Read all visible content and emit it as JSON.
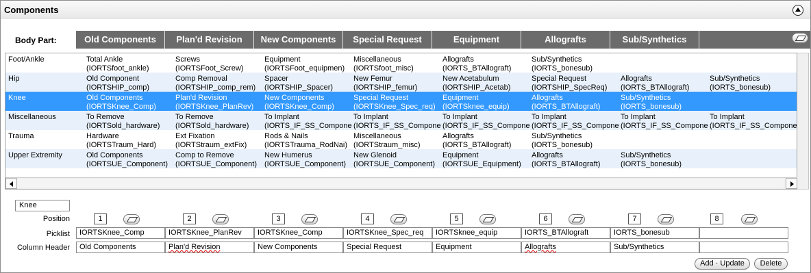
{
  "panel": {
    "title": "Components"
  },
  "body_part_label": "Body Part:",
  "tabs": [
    "Old Components",
    "Plan'd Revision",
    "New Components",
    "Special Request",
    "Equipment",
    "Allografts",
    "Sub/Synthetics"
  ],
  "grid": {
    "rows": [
      {
        "label": "Foot/Ankle",
        "cells": [
          [
            "Total Ankle",
            "(IORTSfoot_ankle)"
          ],
          [
            "Screws",
            "(IORTSFoot_Screw)"
          ],
          [
            "Equipment",
            "(IORTSFoot_equipmen)"
          ],
          [
            "Miscellaneous",
            "(IORTSfoot_misc)"
          ],
          [
            "Allografts",
            "(IORTS_BTAllograft)"
          ],
          [
            "Sub/Synthetics",
            "(IORTS_bonesub)"
          ],
          [
            "",
            ""
          ],
          [
            "",
            ""
          ]
        ]
      },
      {
        "label": "Hip",
        "cells": [
          [
            "Old Component",
            "(IORTSHIP_comp)"
          ],
          [
            "Comp Removal",
            "(IORTSHIP_comp_rem)"
          ],
          [
            "Spacer",
            "(IORTSHIP_Spacer)"
          ],
          [
            "New Femur",
            "(IORTSHIP_femur)"
          ],
          [
            "New Acetabulum",
            "(IORTSHIP_Acetab)"
          ],
          [
            "Special Request",
            "(IORTSHIP_SpecReq)"
          ],
          [
            "Allografts",
            "(IORTS_BTAllograft)"
          ],
          [
            "Sub/Synthetics",
            "(IORTS_bonesub)"
          ]
        ]
      },
      {
        "label": "Knee",
        "cells": [
          [
            "Old Components",
            "(IORTSKnee_Comp)"
          ],
          [
            "Plan'd Revision",
            "(IORTSKnee_PlanRev)"
          ],
          [
            "New Components",
            "(IORTSKnee_Comp)"
          ],
          [
            "Special Request",
            "(IORTSKnee_Spec_req)"
          ],
          [
            "Equipment",
            "(IORTSknee_equip)"
          ],
          [
            "Allografts",
            "(IORTS_BTAllograft)"
          ],
          [
            "Sub/Synthetics",
            "(IORTS_bonesub)"
          ],
          [
            "",
            ""
          ]
        ]
      },
      {
        "label": "Miscellaneous",
        "cells": [
          [
            "To Remove",
            "(IORTSold_hardware)"
          ],
          [
            "To Remove",
            "(IORTSold_hardware)"
          ],
          [
            "To Implant",
            "(IORTS_IF_SS_Componer"
          ],
          [
            "To Implant",
            "(IORTS_IF_SS_Componer"
          ],
          [
            "To Implant",
            "(IORTS_IF_SS_Componer"
          ],
          [
            "To Implant",
            "(IORTS_IF_SS_Componer"
          ],
          [
            "To Implant",
            "(IORTS_IF_SS_Componer"
          ],
          [
            "To Implant",
            "(IORTS_IF_SS_Componer"
          ]
        ]
      },
      {
        "label": "Trauma",
        "cells": [
          [
            "Hardware",
            "(IORTSTraum_Hard)"
          ],
          [
            "Ext Fixation",
            "(IORTStraum_extFix)"
          ],
          [
            "Rods & Nails",
            "(IORTSTrauma_RodNai)"
          ],
          [
            "Miscellaneous",
            "(IORTStraum_misc)"
          ],
          [
            "Allografts",
            "(IORTS_BTAllograft)"
          ],
          [
            "Sub/Synthetics",
            "(IORTS_bonesub)"
          ],
          [
            "",
            ""
          ],
          [
            "",
            ""
          ]
        ]
      },
      {
        "label": "Upper Extremity",
        "cells": [
          [
            "Old Components",
            "(IORTSUE_Component)"
          ],
          [
            "Comp to Remove",
            "(IORTSUE_Component)"
          ],
          [
            "New Humerus",
            "(IORTSUE_Component)"
          ],
          [
            "New Glenoid",
            "(IORTSUE_Component)"
          ],
          [
            "Equipment",
            "(IORTSUE_Equipment)"
          ],
          [
            "Allografts",
            "(IORTS_BTAllograft)"
          ],
          [
            "Sub/Synthetics",
            "(IORTS_bonesub)"
          ],
          [
            "",
            ""
          ]
        ]
      }
    ]
  },
  "editor": {
    "selected_body_part": "Knee",
    "labels": {
      "position": "Position",
      "picklist": "Picklist",
      "column_header": "Column Header"
    },
    "positions": [
      "1",
      "2",
      "3",
      "4",
      "5",
      "6",
      "7",
      "8"
    ],
    "picklists": [
      "IORTSKnee_Comp",
      "IORTSKnee_PlanRev",
      "IORTSKnee_Comp",
      "IORTSKnee_Spec_req",
      "IORTSknee_equip",
      "IORTS_BTAllograft",
      "IORTS_bonesub",
      ""
    ],
    "column_headers": [
      "Old Components",
      "Plan'd Revision",
      "New Components",
      "Special Request",
      "Equipment",
      "Allografts",
      "Sub/Synthetics",
      ""
    ]
  },
  "buttons": {
    "add_update": "Add · Update",
    "delete": "Delete"
  }
}
